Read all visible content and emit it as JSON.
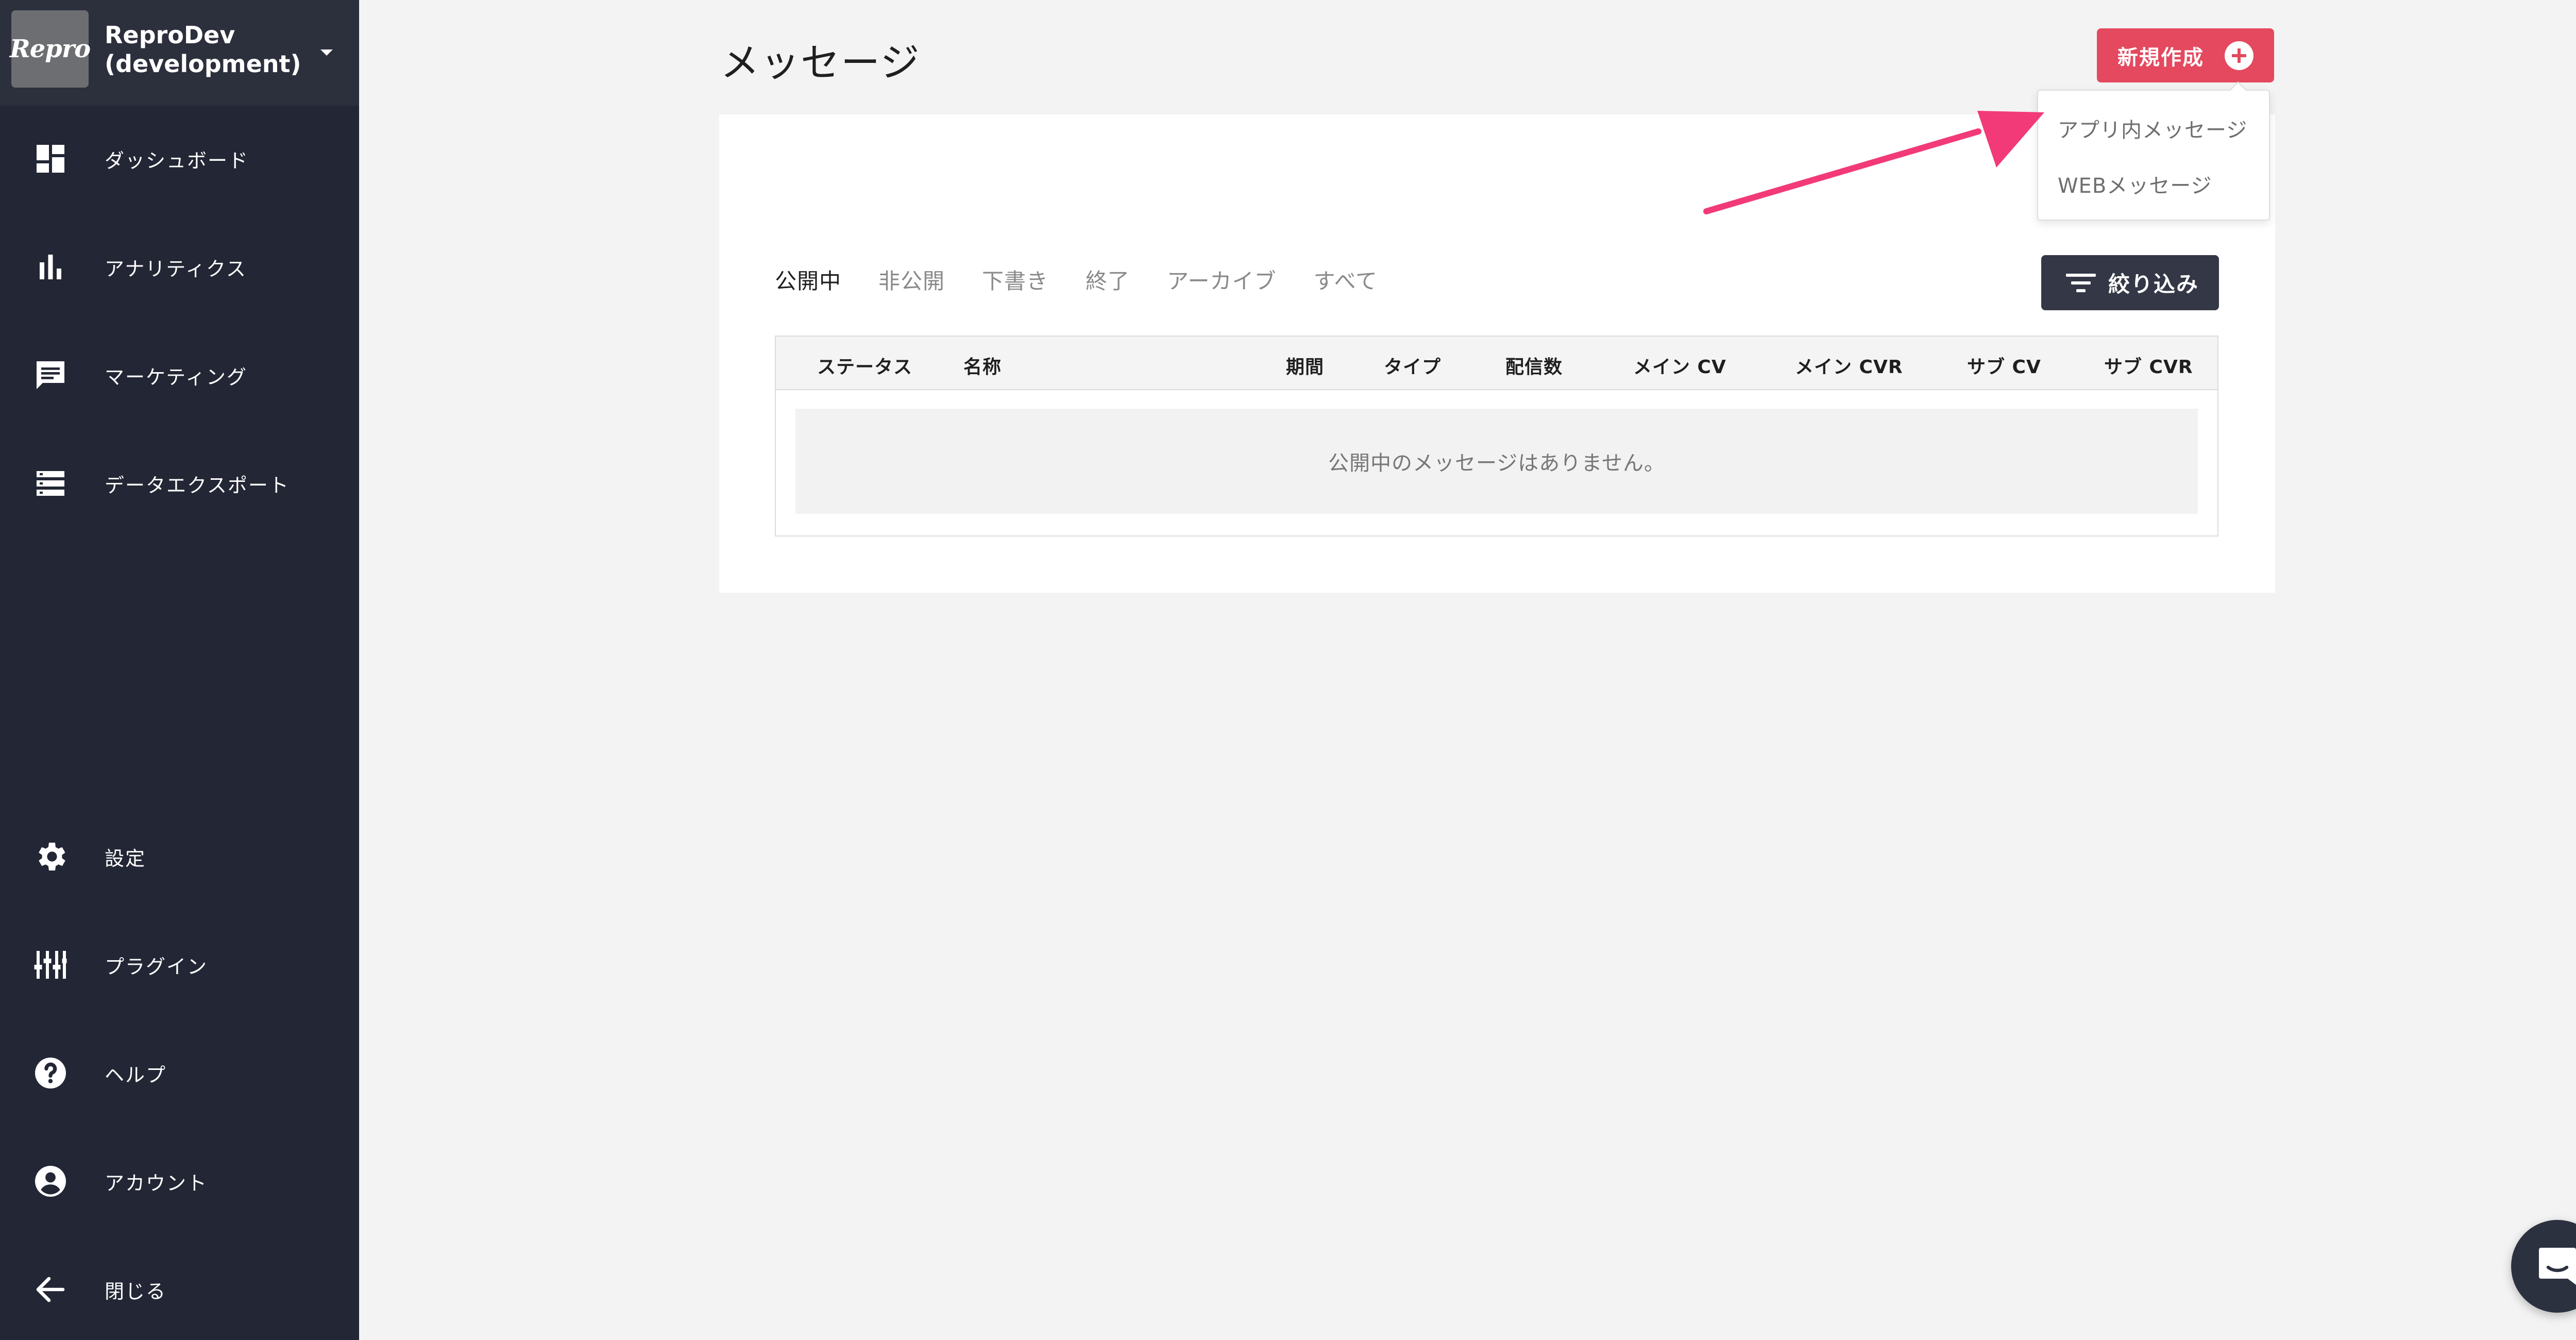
{
  "sidebar": {
    "workspace": {
      "logo_text": "Repro",
      "name_line1": "ReproDev",
      "name_line2": "(development)"
    },
    "items": [
      {
        "label": "ダッシュボード",
        "icon": "dashboard-icon"
      },
      {
        "label": "アナリティクス",
        "icon": "bar-chart-icon"
      },
      {
        "label": "マーケティング",
        "icon": "message-icon"
      },
      {
        "label": "データエクスポート",
        "icon": "storage-icon"
      },
      {
        "label": "設定",
        "icon": "gear-icon"
      },
      {
        "label": "プラグイン",
        "icon": "plugin-icon"
      },
      {
        "label": "ヘルプ",
        "icon": "help-icon"
      },
      {
        "label": "アカウント",
        "icon": "account-icon"
      },
      {
        "label": "閉じる",
        "icon": "arrow-left-icon"
      }
    ]
  },
  "header": {
    "title": "メッセージ",
    "new_button_label": "新規作成"
  },
  "dropdown": {
    "items": [
      "アプリ内メッセージ",
      "WEBメッセージ"
    ]
  },
  "tabs": [
    "公開中",
    "非公開",
    "下書き",
    "終了",
    "アーカイブ",
    "すべて"
  ],
  "active_tab": "公開中",
  "filter": {
    "label": "絞り込み"
  },
  "table": {
    "columns": [
      "ステータス",
      "名称",
      "期間",
      "タイプ",
      "配信数",
      "メイン CV",
      "メイン CVR",
      "サブ CV",
      "サブ CVR"
    ],
    "empty_message": "公開中のメッセージはありません。"
  },
  "colors": {
    "sidebar_bg": "#232634",
    "accent": "#e4495f",
    "annotation_arrow": "#f23a78",
    "filter_button": "#343846"
  }
}
